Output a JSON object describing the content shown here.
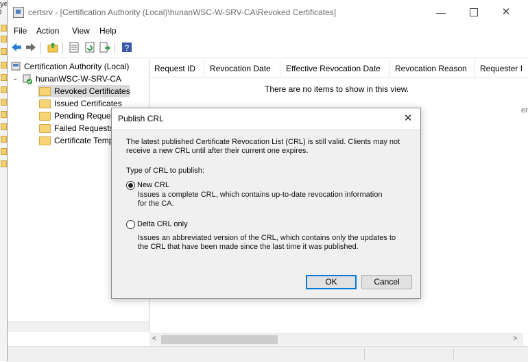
{
  "background": {
    "left_texts": [
      "ayed O",
      "u"
    ],
    "right_text": "en"
  },
  "window": {
    "title": "certsrv - [Certification Authority (Local)\\hunanWSC-W-SRV-CA\\Revoked Certificates]",
    "controls": {
      "minimize": "—",
      "close": "✕"
    }
  },
  "menu": [
    "File",
    "Action",
    "View",
    "Help"
  ],
  "toolbar": {
    "icons": [
      "back-arrow-icon",
      "forward-arrow-icon",
      "up-folder-icon",
      "properties-icon",
      "refresh-icon",
      "export-list-icon",
      "help-icon"
    ]
  },
  "tree": {
    "root": "Certification Authority (Local)",
    "ca": "hunanWSC-W-SRV-CA",
    "items": [
      "Revoked Certificates",
      "Issued Certificates",
      "Pending Request",
      "Failed Requests",
      "Certificate Templ"
    ]
  },
  "list": {
    "columns": [
      "Request ID",
      "Revocation Date",
      "Effective Revocation Date",
      "Revocation Reason",
      "Requester I"
    ],
    "empty_message": "There are no items to show in this view.",
    "scroll_left": "<",
    "scroll_right": ">"
  },
  "dialog": {
    "title": "Publish CRL",
    "close": "✕",
    "intro": "The latest published Certificate Revocation List (CRL) is still valid. Clients may not receive a new CRL until after their current one expires.",
    "type_label": "Type of CRL to publish:",
    "options": [
      {
        "label": "New CRL",
        "checked": true,
        "description": "Issues a complete CRL, which contains up-to-date revocation information for the CA."
      },
      {
        "label": "Delta CRL only",
        "checked": false,
        "description": "Issues an abbreviated version of the CRL, which contains only the updates to the CRL that have been made since the last time it was published."
      }
    ],
    "ok_label": "OK",
    "cancel_label": "Cancel"
  }
}
